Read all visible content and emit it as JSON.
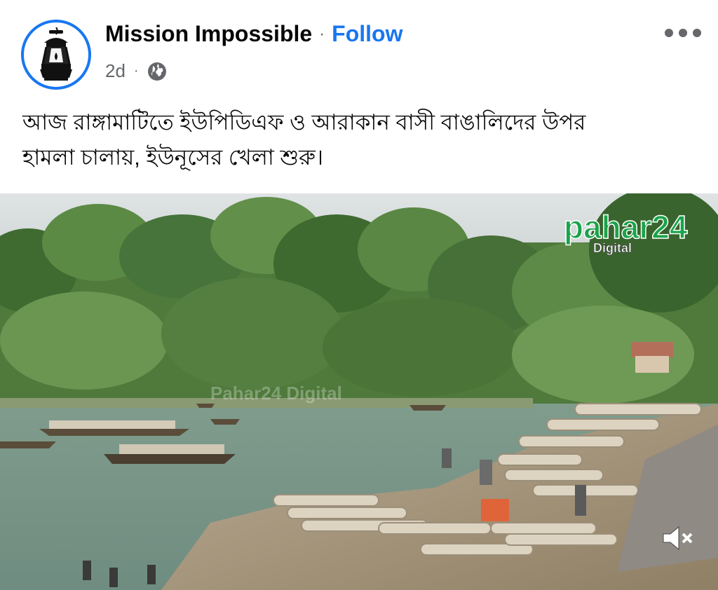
{
  "post": {
    "page_name": "Mission Impossible",
    "separator": "·",
    "follow_label": "Follow",
    "timestamp": "2d",
    "meta_separator": "·",
    "audience_icon": "globe-icon",
    "more_icon": "more-horizontal-icon",
    "caption_line1": "আজ রাঙ্গামাটিতে ইউপিডিএফ ও আরাকান বাসী বাঙালিদের উপর",
    "caption_line2": "হামলা চালায়, ইউনূসের খেলা শুরু।"
  },
  "video": {
    "watermark_brand": "pahar24",
    "watermark_sub": "Digital",
    "faint_watermark": "Pahar24 Digital",
    "mute_icon": "speaker-muted-icon"
  },
  "colors": {
    "brand_blue": "#1877f2",
    "secondary_text": "#65676b",
    "primary_text": "#050505",
    "watermark_green": "#1aa34a",
    "watermark_red": "#e0242a"
  }
}
